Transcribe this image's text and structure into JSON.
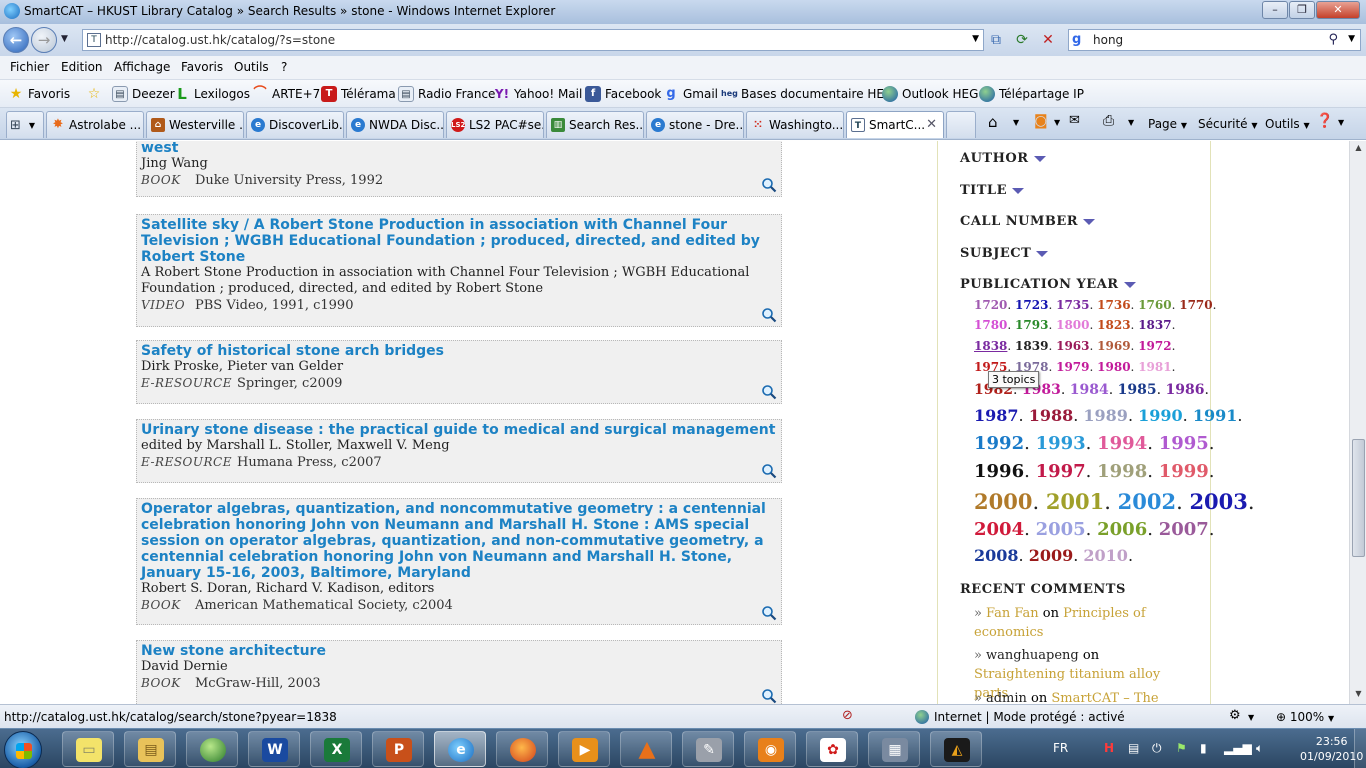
{
  "window": {
    "title": "SmartCAT – HKUST Library Catalog » Search Results » stone - Windows Internet Explorer"
  },
  "address": {
    "url": "http://catalog.ust.hk/catalog/?s=stone",
    "search_query": "hong"
  },
  "menu": [
    "Fichier",
    "Edition",
    "Affichage",
    "Favoris",
    "Outils",
    "?"
  ],
  "favorites": [
    {
      "label": "Favoris",
      "icon": "star-icon"
    },
    {
      "label": "Deezer",
      "icon": "page-icon"
    },
    {
      "label": "Lexilogos",
      "icon": "lexilogos-icon"
    },
    {
      "label": "ARTE+7",
      "icon": "arte-icon"
    },
    {
      "label": "Télérama",
      "icon": "telerama-icon"
    },
    {
      "label": "Radio France",
      "icon": "page-icon"
    },
    {
      "label": "Yahoo! Mail",
      "icon": "yahoo-icon"
    },
    {
      "label": "Facebook",
      "icon": "facebook-icon"
    },
    {
      "label": "Gmail",
      "icon": "gmail-icon"
    },
    {
      "label": "Bases documentaire HEG",
      "icon": "heg-icon"
    },
    {
      "label": "Outlook HEG",
      "icon": "globe-icon"
    },
    {
      "label": "Télépartage IP",
      "icon": "globe-icon"
    }
  ],
  "tabs": [
    {
      "label": "Astrolabe ..."
    },
    {
      "label": "Westerville ..."
    },
    {
      "label": "DiscoverLib..."
    },
    {
      "label": "NWDA Disc..."
    },
    {
      "label": "LS2 PAC#se..."
    },
    {
      "label": "Search Res..."
    },
    {
      "label": "stone - Dre..."
    },
    {
      "label": "Washingto..."
    },
    {
      "label": "SmartC..."
    }
  ],
  "tab_tools": {
    "page": "Page",
    "security": "Sécurité",
    "tools": "Outils"
  },
  "results": [
    {
      "title": "west",
      "author": "Jing Wang",
      "type": "BOOK",
      "publisher": "Duke University Press, 1992"
    },
    {
      "title": "Satellite sky / A Robert Stone Production in association with Channel Four Television ; WGBH Educational Foundation ; produced, directed, and edited by Robert Stone",
      "author": "A Robert Stone Production in association with Channel Four Television ; WGBH Educational Foundation ; produced, directed, and edited by Robert Stone",
      "type": "VIDEO",
      "publisher": "PBS Video, 1991, c1990"
    },
    {
      "title": "Safety of historical stone arch bridges",
      "author": "Dirk Proske, Pieter van Gelder",
      "type": "E-RESOURCE",
      "publisher": "Springer, c2009"
    },
    {
      "title": "Urinary stone disease : the practical guide to medical and surgical management",
      "author": "edited by Marshall L. Stoller, Maxwell V. Meng",
      "type": "E-RESOURCE",
      "publisher": "Humana Press, c2007"
    },
    {
      "title": "Operator algebras, quantization, and noncommutative geometry : a centennial celebration honoring John von Neumann and Marshall H. Stone : AMS special session on operator algebras, quantization, and non-commutative geometry, a centennial celebration honoring John von Neumann and Marshall H. Stone, January 15-16, 2003, Baltimore, Maryland",
      "author": "Robert S. Doran, Richard V. Kadison, editors",
      "type": "BOOK",
      "publisher": "American Mathematical Society, c2004"
    },
    {
      "title": "New stone architecture",
      "author": "David Dernie",
      "type": "BOOK",
      "publisher": "McGraw-Hill, 2003"
    }
  ],
  "facets": {
    "author": "AUTHOR",
    "title": "TITLE",
    "call_number": "CALL NUMBER",
    "subject": "SUBJECT",
    "publication_year": "PUBLICATION YEAR",
    "recent_comments": "RECENT COMMENTS"
  },
  "year_lines": [
    {
      "size": 12,
      "years": [
        [
          "1720",
          "#a05ab0"
        ],
        [
          "1723",
          "#1414b0"
        ],
        [
          "1735",
          "#7a2aa0"
        ],
        [
          "1736",
          "#c24a1a"
        ],
        [
          "1760",
          "#6a9a3a"
        ],
        [
          "1770",
          "#9a2a1a"
        ]
      ]
    },
    {
      "size": 12,
      "years": [
        [
          "1780",
          "#d44fd4"
        ],
        [
          "1793",
          "#2a8a2a"
        ],
        [
          "1800",
          "#e27ad8"
        ],
        [
          "1823",
          "#c24a1a"
        ],
        [
          "1837",
          "#5a1a8a"
        ]
      ]
    },
    {
      "size": 12,
      "years": [
        [
          "1838",
          "#7a2aa0"
        ],
        [
          "1839",
          "#222222"
        ],
        [
          "1963",
          "#9a1a5a"
        ],
        [
          "1969",
          "#b05a3a"
        ],
        [
          "1972",
          "#c21a9a"
        ]
      ]
    },
    {
      "size": 12,
      "years": [
        [
          "1975",
          "#c21a1a"
        ],
        [
          "1978",
          "#7a6a9a"
        ],
        [
          "1979",
          "#c21a9a"
        ],
        [
          "1980",
          "#c21a9a"
        ],
        [
          "1981",
          "#e8a0d8"
        ]
      ]
    },
    {
      "size": 14,
      "years": [
        [
          "1982",
          "#b0201a"
        ],
        [
          "1983",
          "#c21a9a"
        ],
        [
          "1984",
          "#9a5ad0"
        ],
        [
          "1985",
          "#1a3a8a"
        ],
        [
          "1986",
          "#7a2aa0"
        ]
      ]
    },
    {
      "size": 16,
      "years": [
        [
          "1987",
          "#1a1ab0"
        ],
        [
          "1988",
          "#9a1a3a"
        ],
        [
          "1989",
          "#9aa0c0"
        ],
        [
          "1990",
          "#1aa0d8"
        ],
        [
          "1991",
          "#1a8ac8"
        ]
      ]
    },
    {
      "size": 18,
      "years": [
        [
          "1992",
          "#1a7ac8"
        ],
        [
          "1993",
          "#2a9ad8"
        ],
        [
          "1994",
          "#e05a9a"
        ],
        [
          "1995",
          "#b05ad0"
        ]
      ]
    },
    {
      "size": 18,
      "years": [
        [
          "1996",
          "#111111"
        ],
        [
          "1997",
          "#c21a4a"
        ],
        [
          "1998",
          "#a0a07a"
        ],
        [
          "1999",
          "#e05a6a"
        ]
      ]
    },
    {
      "size": 21,
      "years": [
        [
          "2000",
          "#b07a2a"
        ],
        [
          "2001",
          "#a0a02a"
        ],
        [
          "2002",
          "#2a8ad8"
        ],
        [
          "2003",
          "#1a1ab0"
        ]
      ]
    },
    {
      "size": 18,
      "years": [
        [
          "2004",
          "#d01a3a"
        ],
        [
          "2005",
          "#9aa0e0"
        ],
        [
          "2006",
          "#7aa02a"
        ],
        [
          "2007",
          "#9a5a9a"
        ]
      ]
    },
    {
      "size": 16,
      "years": [
        [
          "2008",
          "#1a3a9a"
        ],
        [
          "2009",
          "#9a1a1a"
        ],
        [
          "2010",
          "#c0a0c8"
        ]
      ]
    }
  ],
  "year_tooltip": "3 topics",
  "comments": [
    {
      "author": "Fan Fan",
      "on": "on",
      "post": "Principles of economics"
    },
    {
      "author": "wanghuapeng",
      "on": "on",
      "post": "Straightening titanium alloy parts"
    },
    {
      "author": "admin",
      "on": "on",
      "post": "SmartCAT – The"
    }
  ],
  "status": {
    "link": "http://catalog.ust.hk/catalog/search/stone?pyear=1838",
    "zone": "Internet | Mode protégé : activé",
    "zoom": "100%"
  },
  "taskbar": {
    "lang": "FR",
    "time": "23:56",
    "date": "01/09/2010"
  },
  "colors": {
    "link": "#1d82c4",
    "comment_post": "#c7a237",
    "result_bg": "#f0f0f0"
  }
}
